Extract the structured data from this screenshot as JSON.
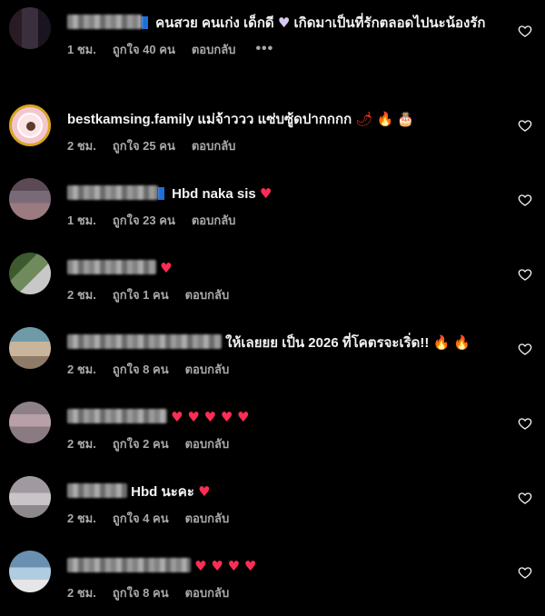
{
  "comments": [
    {
      "text": "คนสวย คนเก่ง เด็กดี",
      "text_after": "เกิดมาเป็นที่รักตลอดไปนะน้องรัก",
      "emoji_heart": "♥",
      "time": "1 ชม.",
      "likes": "ถูกใจ 40 คน",
      "reply": "ตอบกลับ",
      "more": "•••"
    },
    {
      "username": "bestkamsing.family",
      "text": "แม่จ้าววว แซ่บซู้ดปากกกก",
      "emojis": [
        "🌶",
        "🔥",
        "🎂"
      ],
      "time": "2 ชม.",
      "likes": "ถูกใจ 25 คน",
      "reply": "ตอบกลับ"
    },
    {
      "text": "Hbd naka sis",
      "emoji_heart": "♥",
      "time": "1 ชม.",
      "likes": "ถูกใจ 23 คน",
      "reply": "ตอบกลับ"
    },
    {
      "emoji_heart": "♥",
      "time": "2 ชม.",
      "likes": "ถูกใจ 1 คน",
      "reply": "ตอบกลับ"
    },
    {
      "text": "ให้เลยยย เป็น 2026 ที่โคตรจะเริ่ด!!",
      "emojis": [
        "🔥",
        "🔥"
      ],
      "time": "2 ชม.",
      "likes": "ถูกใจ 8 คน",
      "reply": "ตอบกลับ"
    },
    {
      "hearts": "♥ ♥ ♥ ♥ ♥",
      "time": "2 ชม.",
      "likes": "ถูกใจ 2 คน",
      "reply": "ตอบกลับ"
    },
    {
      "text": "Hbd นะคะ",
      "emoji_heart": "♥",
      "time": "2 ชม.",
      "likes": "ถูกใจ 4 คน",
      "reply": "ตอบกลับ"
    },
    {
      "hearts": "♥ ♥ ♥ ♥",
      "time": "2 ชม.",
      "likes": "ถูกใจ 8 คน",
      "reply": "ตอบกลับ"
    }
  ],
  "icons": {
    "like": "heart-outline-icon"
  },
  "colors": {
    "background": "#000000",
    "meta": "#a8a8a8",
    "heart": "#ff2d55",
    "verified_badge": "#1d6fd8"
  }
}
